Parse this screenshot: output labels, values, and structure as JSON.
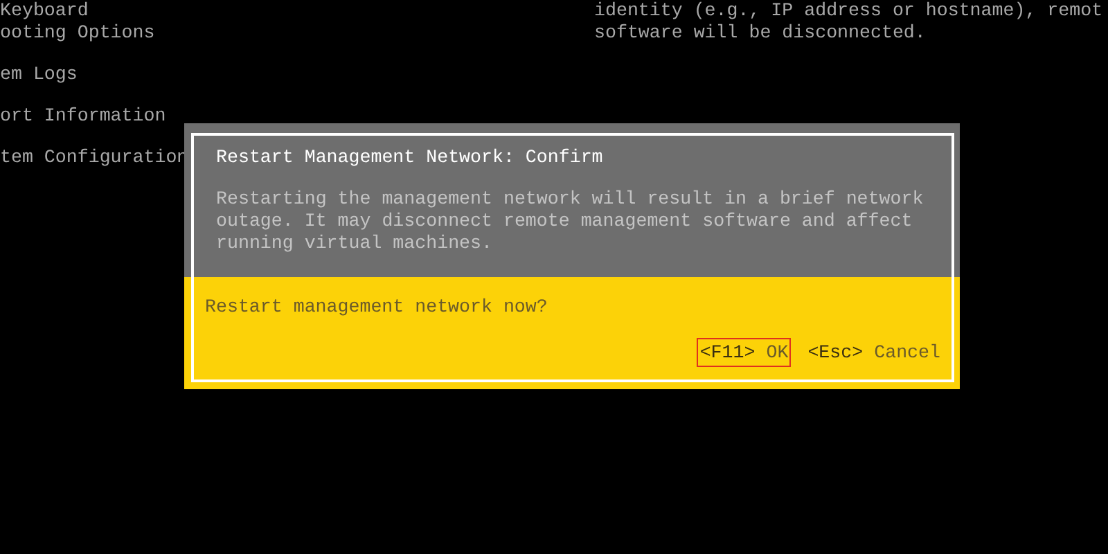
{
  "background_menu": [
    "Keyboard",
    "ooting Options",
    "em Logs",
    "ort Information",
    "tem Configuration"
  ],
  "background_info": [
    "identity (e.g., IP address or hostname), remot",
    "software will be disconnected."
  ],
  "dialog": {
    "title": "Restart Management Network: Confirm",
    "message": "Restarting the management network will result in a brief network outage. It may disconnect remote management software and affect running virtual machines.",
    "question": "Restart management network now?",
    "buttons": [
      {
        "key": "<F11>",
        "label": "OK",
        "selected": true
      },
      {
        "key": "<Esc>",
        "label": "Cancel",
        "selected": false
      }
    ]
  }
}
